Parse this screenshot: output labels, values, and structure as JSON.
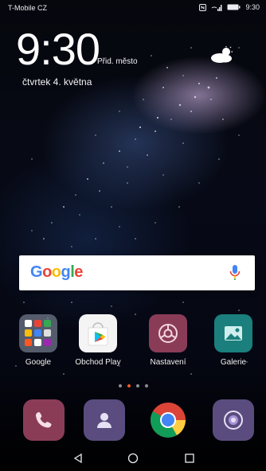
{
  "status_bar": {
    "carrier": "T-Mobile CZ",
    "time": "9:30",
    "icons": [
      "nfc-icon",
      "wifi-icon",
      "signal-icon",
      "battery-icon"
    ]
  },
  "clock_widget": {
    "time": "9:30",
    "city": "Přid. město",
    "date": "čtvrtek 4. května",
    "weather_icon": "partly-cloudy-icon"
  },
  "search_widget": {
    "logo_text": "Google",
    "logo_colors": [
      "#4285F4",
      "#EA4335",
      "#FBBC05",
      "#4285F4",
      "#34A853",
      "#EA4335"
    ],
    "mic_icon": "microphone-icon"
  },
  "home_apps": [
    {
      "label": "Google",
      "icon": "google-folder-icon"
    },
    {
      "label": "Obchod Play",
      "icon": "play-store-icon"
    },
    {
      "label": "Nastavení",
      "icon": "settings-icon"
    },
    {
      "label": "Galerie",
      "icon": "gallery-icon"
    }
  ],
  "pager": {
    "pages": 4,
    "active_index": 1
  },
  "dock": [
    {
      "icon": "phone-icon"
    },
    {
      "icon": "contacts-icon"
    },
    {
      "icon": "chrome-icon"
    },
    {
      "icon": "camera-icon"
    }
  ],
  "nav_bar": {
    "buttons": [
      "back-icon",
      "home-icon",
      "recents-icon"
    ]
  }
}
